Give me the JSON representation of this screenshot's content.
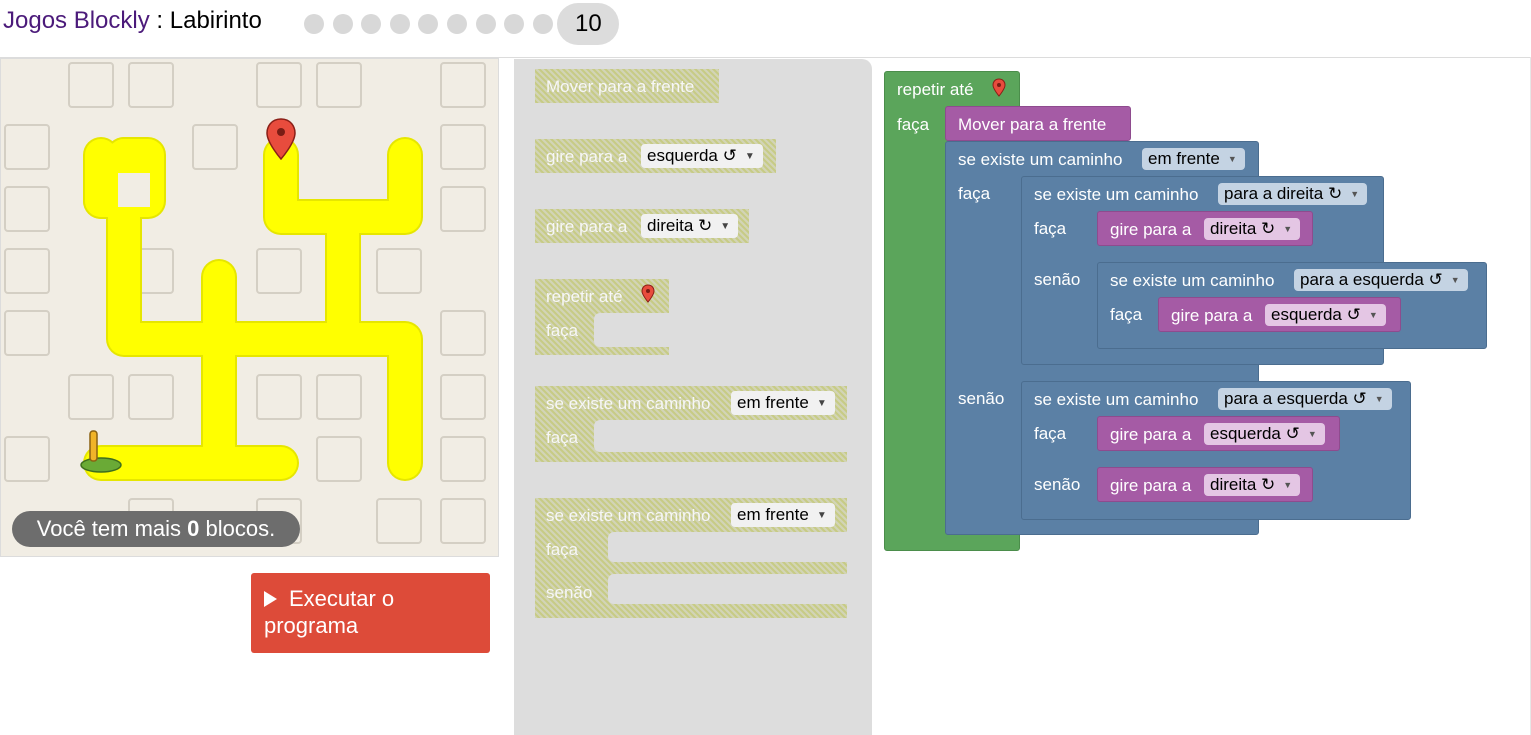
{
  "header": {
    "app_name": "Jogos Blockly",
    "separator": " : ",
    "game_name": "Labirinto",
    "current_level": "10",
    "level_dots": 9
  },
  "maze": {
    "capacity_prefix": "Você tem mais ",
    "capacity_count": "0",
    "capacity_suffix": " blocos.",
    "icons": [
      "marker-icon",
      "pegman-icon"
    ]
  },
  "run_button": {
    "label": "Executar o programa",
    "icon": "play-icon",
    "color": "#dd4b39"
  },
  "toolbox": {
    "move_forward": "Mover para a frente",
    "turn_label": "gire para a",
    "turn_left_value": "esquerda ↺",
    "turn_right_value": "direita ↻",
    "repeat_until": "repetir até",
    "do": "faça",
    "if_path": "se existe um caminho",
    "ahead_value": "em frente",
    "else": "senão"
  },
  "workspace": {
    "repeat_until": "repetir até",
    "do": "faça",
    "else": "senão",
    "move_forward": "Mover para a frente",
    "if_path": "se existe um caminho",
    "turn_label": "gire para a",
    "dir_ahead": "em frente",
    "dir_right": "para a direita ↻",
    "dir_left": "para a esquerda ↺",
    "turn_left": "esquerda ↺",
    "turn_right": "direita ↻"
  },
  "colors": {
    "loop_block": "#5ba55b",
    "logic_block": "#5b80a5",
    "movement_block": "#a55ba5",
    "maze_path": "#ffff00",
    "disabled_block": "#c7cb86"
  }
}
